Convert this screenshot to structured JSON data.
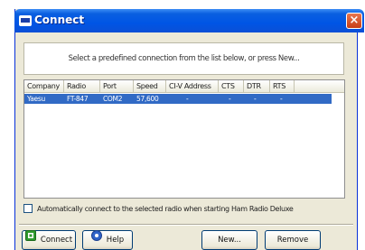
{
  "window": {
    "title": "Connect",
    "close_glyph": "×"
  },
  "instruction": "Select a predefined connection from the list below, or press New...",
  "list": {
    "columns": [
      "Company",
      "Radio",
      "Port",
      "Speed",
      "CI-V Address",
      "CTS",
      "DTR",
      "RTS"
    ],
    "rows": [
      {
        "company": "Yaesu",
        "radio": "FT-847",
        "port": "COM2",
        "speed": "57,600",
        "civ_address": "-",
        "cts": "-",
        "dtr": "-",
        "rts": "-",
        "selected": true
      }
    ]
  },
  "auto_connect": {
    "label": "Automatically connect to the selected radio when starting Ham Radio Deluxe",
    "checked": false
  },
  "buttons": {
    "connect": "Connect",
    "help": "Help",
    "new": "New...",
    "remove": "Remove"
  },
  "icons": {
    "app": "ham-radio-app-icon",
    "connect": "green-connect-icon",
    "help": "blue-help-icon",
    "close": "close-icon"
  },
  "colors": {
    "titlebar": "#0055e5",
    "selection": "#316ac5",
    "dialog_bg": "#ece9d8",
    "close_button": "#c83e17"
  }
}
